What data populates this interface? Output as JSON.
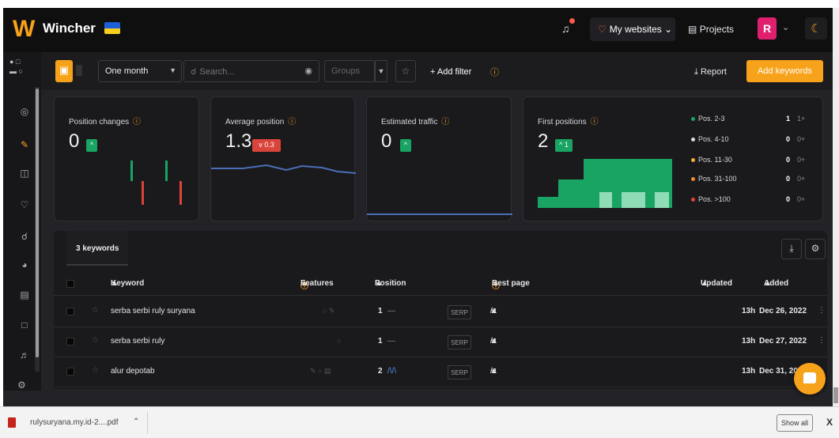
{
  "header": {
    "logo": "W",
    "brand": "Wincher",
    "nav_sites": "My websites",
    "nav_projects": "Projects",
    "avatar_initial": "R",
    "colors": {
      "accent": "#f7a21b",
      "header_bg": "#0f0f10",
      "avatar": "#e0206f"
    }
  },
  "toolbar": {
    "period": "One month",
    "search_placeholder": "Search...",
    "groups_placeholder": "Groups",
    "add_filter": "+ Add filter",
    "report": "Report",
    "add_keywords": "Add keywords"
  },
  "cards": {
    "position_changes": {
      "title": "Position changes",
      "value": "0",
      "badge": "^"
    },
    "average_position": {
      "title": "Average position",
      "value": "1.3",
      "badge": "v 0.3"
    },
    "estimated_traffic": {
      "title": "Estimated traffic",
      "value": "0",
      "badge": "^"
    },
    "first_positions": {
      "title": "First positions",
      "value": "2",
      "badge": "^ 1",
      "legend": [
        {
          "label": "Pos. 2-3",
          "count": "1",
          "change": "1+",
          "color": "#19a463"
        },
        {
          "label": "Pos. 4-10",
          "count": "0",
          "change": "0+",
          "color": "#dcdce0"
        },
        {
          "label": "Pos. 11-30",
          "count": "0",
          "change": "0+",
          "color": "#f0b22a"
        },
        {
          "label": "Pos. 31-100",
          "count": "0",
          "change": "0+",
          "color": "#f08a2a"
        },
        {
          "label": "Pos. >100",
          "count": "0",
          "change": "0+",
          "color": "#e0443b"
        }
      ]
    }
  },
  "table": {
    "tab": "3 keywords",
    "headers": {
      "keyword": "Keyword",
      "features": "Features",
      "position": "Position",
      "best_page": "Best page",
      "updated": "Updated",
      "added": "Added"
    },
    "rows": [
      {
        "keyword": "serba serbi ruly suryana",
        "position": "1",
        "trend": "—",
        "serp": "SERP",
        "updated": "13h",
        "added": "Dec 26, 2022"
      },
      {
        "keyword": "serba serbi ruly",
        "position": "1",
        "trend": "—",
        "serp": "SERP",
        "updated": "13h",
        "added": "Dec 27, 2022"
      },
      {
        "keyword": "alur depotab",
        "position": "2",
        "trend": "/\\/\\",
        "serp": "SERP",
        "updated": "13h",
        "added": "Dec 31, 2022"
      }
    ]
  },
  "download_bar": {
    "filename": "rulysuryana.my.id-2....pdf",
    "show_all": "Show all",
    "close": "X"
  }
}
